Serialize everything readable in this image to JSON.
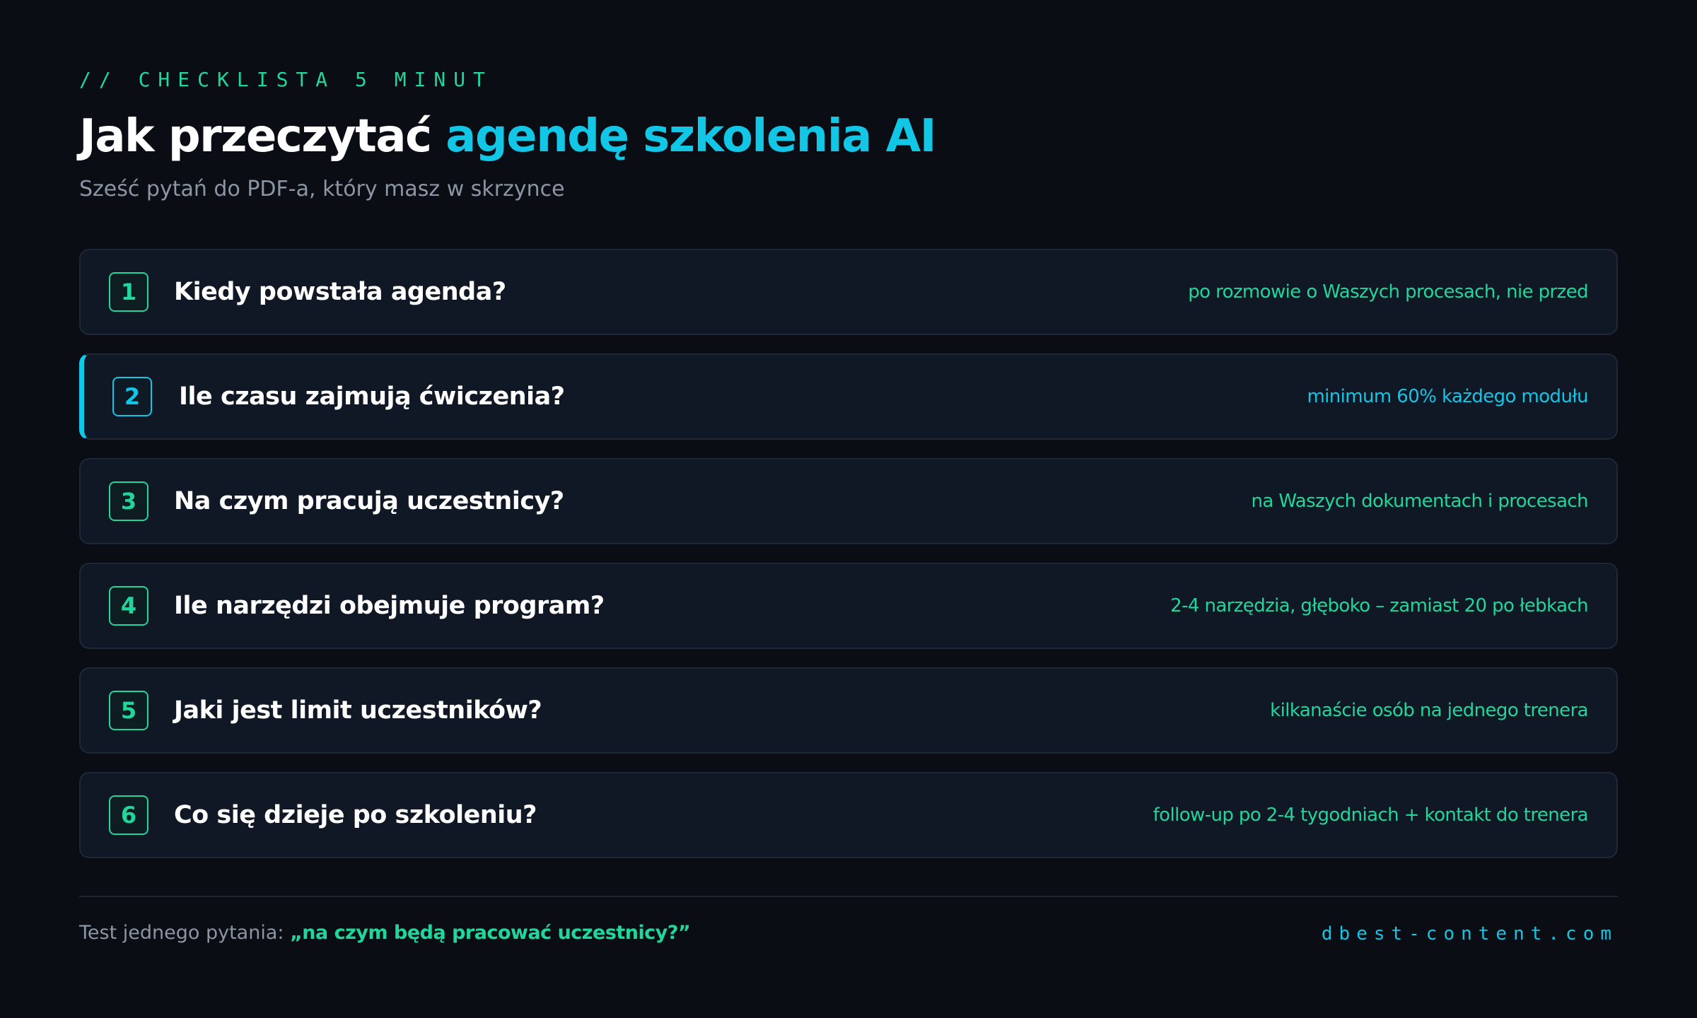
{
  "header": {
    "eyebrow": "// CHECKLISTA 5 MINUT",
    "title_main": "Jak przeczytać ",
    "title_accent": "agendę szkolenia AI",
    "subtitle": "Sześć pytań do PDF-a, który masz w skrzynce"
  },
  "checklist": {
    "items": [
      {
        "number": "1",
        "question": "Kiedy powstała agenda?",
        "answer": "po rozmowie o Waszych procesach, nie przed"
      },
      {
        "number": "2",
        "question": "Ile czasu zajmują ćwiczenia?",
        "answer": "minimum 60% każdego modułu"
      },
      {
        "number": "3",
        "question": "Na czym pracują uczestnicy?",
        "answer": "na Waszych dokumentach i procesach"
      },
      {
        "number": "4",
        "question": "Ile narzędzi obejmuje program?",
        "answer": "2-4 narzędzia, głęboko – zamiast 20 po łebkach"
      },
      {
        "number": "5",
        "question": "Jaki jest limit uczestników?",
        "answer": "kilkanaście osób na jednego trenera"
      },
      {
        "number": "6",
        "question": "Co się dzieje po szkoleniu?",
        "answer": "follow-up po 2-4 tygodniach + kontakt do trenera"
      }
    ]
  },
  "footer": {
    "test_label": "Test jednego pytania: ",
    "test_question": "„na czym będą pracować uczestnicy?”",
    "site": "dbest-content.com"
  },
  "colors": {
    "background": "#0a0d13",
    "card": "#101725",
    "accent_green": "#20d69a",
    "accent_cyan": "#12c6e6",
    "muted_text": "#8c95a3"
  }
}
